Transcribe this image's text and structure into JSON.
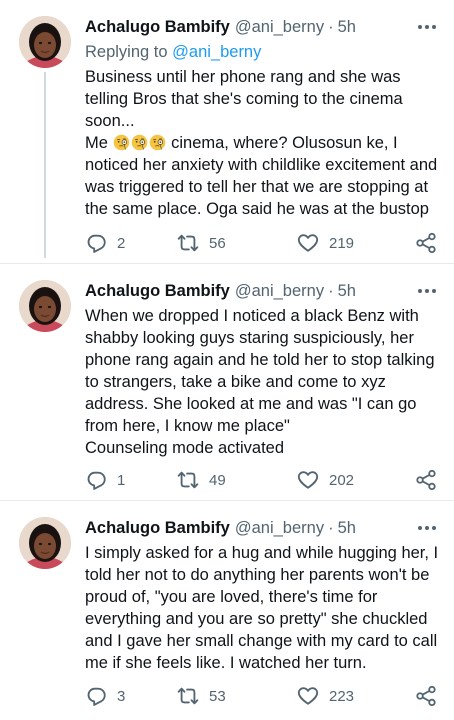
{
  "tweets": [
    {
      "name": "Achalugo Bambify",
      "handle": "@ani_berny",
      "dot": "·",
      "time": "5h",
      "replying_prefix": "Replying to ",
      "replying_to": "@ani_berny",
      "lines": [
        "Business until her phone rang and she was",
        "telling Bros that she's coming to the cinema",
        "soon...",
        "cinema, where? Olusosun ke, I",
        "noticed her anxiety with childlike excitement and",
        "was triggered to tell her that we are stopping at",
        "the same place. Oga said he was at the bustop"
      ],
      "line4_prefix": "Me",
      "replies": "2",
      "retweets": "56",
      "likes": "219"
    },
    {
      "name": "Achalugo Bambify",
      "handle": "@ani_berny",
      "dot": "·",
      "time": "5h",
      "lines": [
        "When we dropped I noticed a black Benz with",
        "shabby looking guys staring suspiciously, her",
        "phone rang again and he told her to stop talking",
        "to strangers, take a bike and come to xyz",
        "address. She looked at me and was \"I can go",
        "from here, I know me place\"",
        "Counseling mode activated"
      ],
      "replies": "1",
      "retweets": "49",
      "likes": "202"
    },
    {
      "name": "Achalugo Bambify",
      "handle": "@ani_berny",
      "dot": "·",
      "time": "5h",
      "lines": [
        "I simply asked for a hug and while hugging her, I",
        "told her not to do anything her parents won't be",
        "proud of, \"you are loved, there's time for",
        "everything and you are so pretty\" she chuckled",
        "and I gave her small change with my card to call",
        "me if she feels like. I watched her turn."
      ],
      "replies": "3",
      "retweets": "53",
      "likes": "223"
    }
  ],
  "icons": {
    "emoji": "face-with-monocle-icon",
    "more": "more-options-icon",
    "reply": "reply-icon",
    "retweet": "retweet-icon",
    "like": "heart-icon",
    "share": "share-icon"
  },
  "colors": {
    "text": "#0f1419",
    "secondary": "#536471",
    "link": "#1d9bf0",
    "divider": "#e7e9ea",
    "thread_line": "#cfd9de"
  }
}
